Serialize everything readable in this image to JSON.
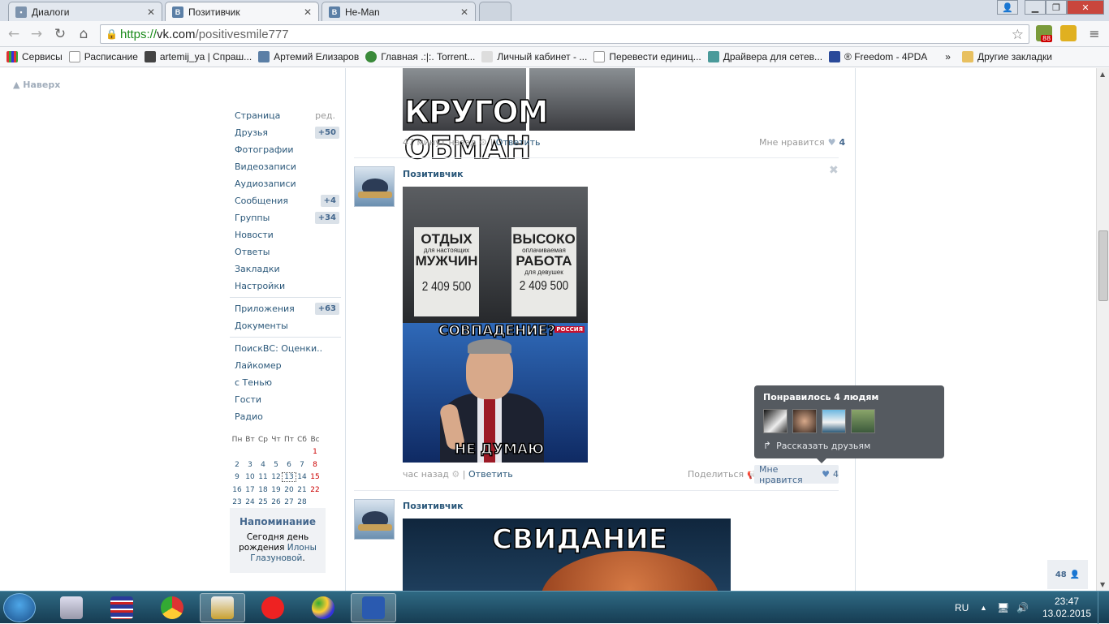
{
  "browser": {
    "tabs": [
      {
        "title": "Диалоги",
        "icon": "speech-bubble-icon"
      },
      {
        "title": "Позитивчик",
        "icon": "vk-icon"
      },
      {
        "title": "He-Man",
        "icon": "vk-icon"
      }
    ],
    "url": {
      "scheme": "https://",
      "host": "vk.com",
      "path": "/positivesmile777"
    },
    "ext_badge": "88",
    "bookmarks": [
      {
        "label": "Сервисы"
      },
      {
        "label": "Расписание"
      },
      {
        "label": "artemij_ya | Спраш..."
      },
      {
        "label": "Артемий Елизаров"
      },
      {
        "label": "Главная .:|:. Torrent..."
      },
      {
        "label": "Личный кабинет - ..."
      },
      {
        "label": "Перевести единиц..."
      },
      {
        "label": "Драйвера для сетев..."
      },
      {
        "label": "® Freedom - 4PDA"
      }
    ],
    "bookmarks_more": "»",
    "other_bookmarks": "Другие закладки"
  },
  "page": {
    "to_top": "Наверх",
    "nav": [
      {
        "label": "Страница",
        "extra": "ред."
      },
      {
        "label": "Друзья",
        "badge": "+50"
      },
      {
        "label": "Фотографии"
      },
      {
        "label": "Видеозаписи"
      },
      {
        "label": "Аудиозаписи"
      },
      {
        "label": "Сообщения",
        "badge": "+4"
      },
      {
        "label": "Группы",
        "badge": "+34"
      },
      {
        "label": "Новости"
      },
      {
        "label": "Ответы"
      },
      {
        "label": "Закладки"
      },
      {
        "label": "Настройки"
      }
    ],
    "nav2": [
      {
        "label": "Приложения",
        "badge": "+63"
      },
      {
        "label": "Документы"
      }
    ],
    "apps": [
      {
        "label": "ПоискВС: Оценки.."
      },
      {
        "label": "Лайкомер"
      },
      {
        "label": "с Тенью"
      },
      {
        "label": "Гости"
      },
      {
        "label": "Радио"
      }
    ],
    "calendar": {
      "weekdays": [
        "Пн",
        "Вт",
        "Ср",
        "Чт",
        "Пт",
        "Сб",
        "Вс"
      ],
      "weeks": [
        [
          "",
          "",
          "",
          "",
          "",
          "",
          "1"
        ],
        [
          "2",
          "3",
          "4",
          "5",
          "6",
          "7",
          "8"
        ],
        [
          "9",
          "10",
          "11",
          "12",
          "13",
          "14",
          "15"
        ],
        [
          "16",
          "17",
          "18",
          "19",
          "20",
          "21",
          "22"
        ],
        [
          "23",
          "24",
          "25",
          "26",
          "27",
          "28",
          ""
        ]
      ],
      "today": "13"
    },
    "reminder": {
      "title": "Напоминание",
      "pre": "Сегодня",
      "word_day": "день",
      "word_birth": "рождения",
      "name1": "Илоны",
      "name2": "Глазуновой",
      "dot": "."
    },
    "posts": [
      {
        "caption": "КРУГОМ ОБМАН",
        "time": "47 минут назад",
        "reply": "Ответить",
        "like_label": "Мне нравится",
        "likes": "4"
      },
      {
        "author": "Позитивчик",
        "sign1_big": "ОТДЫХ",
        "sign1_small": "для настоящих",
        "sign1_big2": "МУЖЧИН",
        "sign1_price": "2 409 500",
        "sign2_big": "ВЫСОКО",
        "sign2_small": "оплачиваемая",
        "sign2_big2": "РАБОТА",
        "sign2_small2": "для девушек",
        "sign2_price": "2 409 500",
        "cap_top": "СОВПАДЕНИЕ?",
        "cap_bottom": "НЕ ДУМАЮ",
        "channel": "РОССИЯ",
        "time": "час назад",
        "reply": "Ответить",
        "share": "Поделиться",
        "like_label": "Мне нравится",
        "likes": "4"
      },
      {
        "author": "Позитивчик",
        "caption": "СВИДАНИЕ"
      }
    ],
    "likes_tooltip": {
      "title": "Понравилось 4 людям",
      "tell": "Рассказать друзьям"
    },
    "side_counter": "48",
    "separator": "|"
  },
  "taskbar": {
    "lang": "RU",
    "time": "23:47",
    "date": "13.02.2015"
  }
}
